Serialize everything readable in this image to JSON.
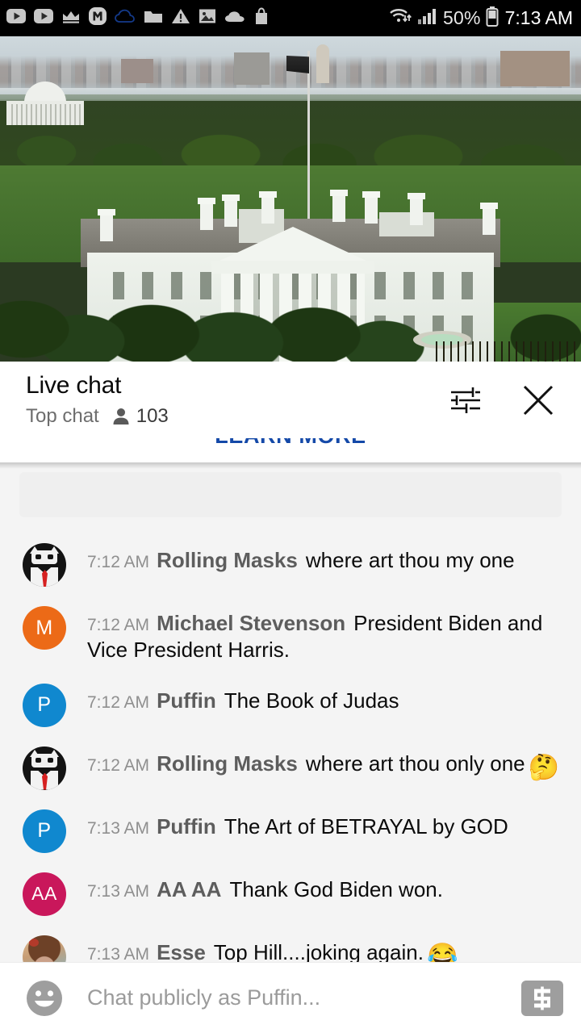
{
  "statusbar": {
    "left_icons": [
      {
        "name": "youtube-icon"
      },
      {
        "name": "youtube-play-icon"
      },
      {
        "name": "crown-icon"
      },
      {
        "name": "mobizen-m-icon"
      },
      {
        "name": "cloud-outline-icon"
      },
      {
        "name": "folder-icon"
      },
      {
        "name": "warning-triangle-icon"
      },
      {
        "name": "image-icon"
      },
      {
        "name": "cloud-filled-icon"
      },
      {
        "name": "shopping-bag-icon"
      }
    ],
    "wifi_icon": "wifi-icon",
    "signal_icon": "cellular-signal-icon",
    "battery_percent": "50%",
    "battery_icon": "battery-icon",
    "time": "7:13 AM"
  },
  "video": {
    "name": "white-house-live-stream",
    "progress_color": "#ff0000",
    "progress_percent": 100
  },
  "chat_header": {
    "title": "Live chat",
    "mode": "Top chat",
    "viewer_icon": "person-icon",
    "viewer_count": "103",
    "settings_icon": "tune-sliders-icon",
    "close_icon": "close-x-icon"
  },
  "promo": {
    "learn_more_label": "LEARN MORE",
    "link_color": "#1449a8"
  },
  "messages": [
    {
      "time": "7:12 AM",
      "author": "Rolling Masks",
      "text": "where art thou my one",
      "emoji": "",
      "avatar_type": "mask",
      "avatar_color": "#131313",
      "avatar_initials": ""
    },
    {
      "time": "7:12 AM",
      "author": "Michael Stevenson",
      "text": "President Biden and Vice President Harris.",
      "emoji": "",
      "avatar_type": "initial",
      "avatar_color": "#ec6a17",
      "avatar_initials": "M"
    },
    {
      "time": "7:12 AM",
      "author": "Puffin",
      "text": "The Book of Judas",
      "emoji": "",
      "avatar_type": "initial",
      "avatar_color": "#1088cf",
      "avatar_initials": "P"
    },
    {
      "time": "7:12 AM",
      "author": "Rolling Masks",
      "text": "where art thou only one",
      "emoji": "🤔",
      "avatar_type": "mask",
      "avatar_color": "#131313",
      "avatar_initials": ""
    },
    {
      "time": "7:13 AM",
      "author": "Puffin",
      "text": "The Art of BETRAYAL by GOD",
      "emoji": "",
      "avatar_type": "initial",
      "avatar_color": "#1088cf",
      "avatar_initials": "P"
    },
    {
      "time": "7:13 AM",
      "author": "AA AA",
      "text": "Thank God Biden won.",
      "emoji": "",
      "avatar_type": "initial",
      "avatar_color": "#c9175b",
      "avatar_initials": "AA"
    },
    {
      "time": "7:13 AM",
      "author": "Esse",
      "text": "Top Hill....joking again.",
      "emoji": "😂",
      "avatar_type": "photo",
      "avatar_color": "#c69c74",
      "avatar_initials": ""
    }
  ],
  "composer": {
    "emoji_icon": "emoji-smiley-icon",
    "placeholder": "Chat publicly as Puffin...",
    "value": "",
    "superchat_icon": "super-chat-dollar-icon"
  }
}
